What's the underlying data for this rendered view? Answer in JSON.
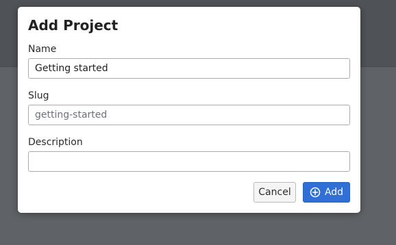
{
  "modal": {
    "title": "Add Project",
    "fields": {
      "name": {
        "label": "Name",
        "value": "Getting started"
      },
      "slug": {
        "label": "Slug",
        "value": "",
        "placeholder": "getting-started"
      },
      "description": {
        "label": "Description",
        "value": ""
      }
    },
    "buttons": {
      "cancel": "Cancel",
      "add": "Add",
      "add_icon": "plus-circle-icon"
    }
  },
  "colors": {
    "primary": "#2f6fd6",
    "overlay": "#5c5f63"
  }
}
